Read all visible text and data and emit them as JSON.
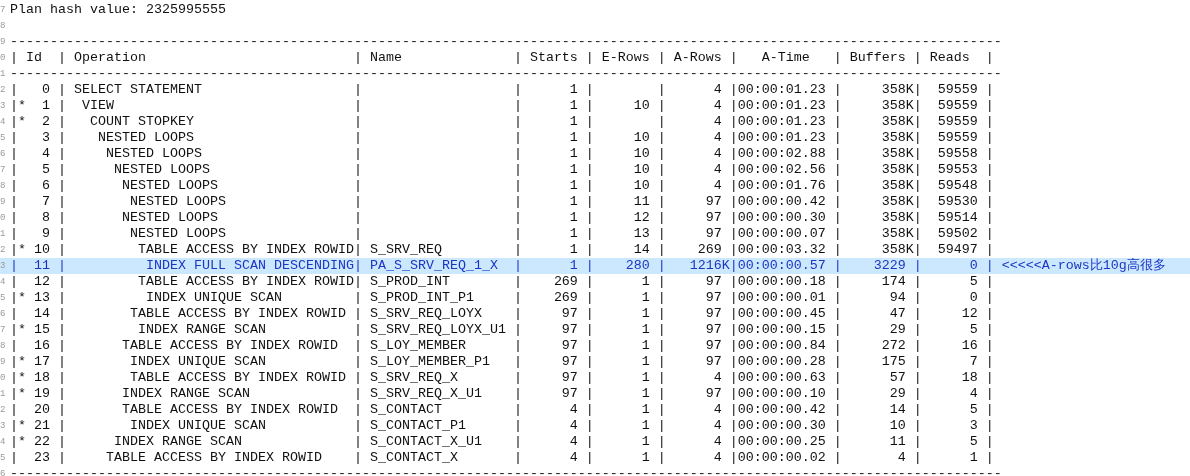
{
  "editor": {
    "lines": [
      {
        "number": "7",
        "text": "Plan hash value: 2325995555",
        "selected": false
      },
      {
        "number": "8",
        "selected": false
      },
      {
        "number": "9",
        "text": "----------------------------------------------------------------------------------------------------------------------------",
        "selected": false
      },
      {
        "number": "0",
        "text": "| Id  | Operation                          | Name              | Starts | E-Rows | A-Rows |   A-Time   | Buffers | Reads  |",
        "selected": false
      },
      {
        "number": "1",
        "text": "----------------------------------------------------------------------------------------------------------------------------",
        "selected": false
      },
      {
        "number": "2",
        "text": "|   0 | SELECT STATEMENT                   |                   |      1 |        |      4 |00:00:01.23 |     358K|  59559 |",
        "selected": false
      },
      {
        "number": "3",
        "text": "|*  1 |  VIEW                              |                   |      1 |     10 |      4 |00:00:01.23 |     358K|  59559 |",
        "selected": false
      },
      {
        "number": "4",
        "text": "|*  2 |   COUNT STOPKEY                    |                   |      1 |        |      4 |00:00:01.23 |     358K|  59559 |",
        "selected": false
      },
      {
        "number": "5",
        "text": "|   3 |    NESTED LOOPS                    |                   |      1 |     10 |      4 |00:00:01.23 |     358K|  59559 |",
        "selected": false
      },
      {
        "number": "6",
        "text": "|   4 |     NESTED LOOPS                   |                   |      1 |     10 |      4 |00:00:02.88 |     358K|  59558 |",
        "selected": false
      },
      {
        "number": "7",
        "text": "|   5 |      NESTED LOOPS                  |                   |      1 |     10 |      4 |00:00:02.56 |     358K|  59553 |",
        "selected": false
      },
      {
        "number": "8",
        "text": "|   6 |       NESTED LOOPS                 |                   |      1 |     10 |      4 |00:00:01.76 |     358K|  59548 |",
        "selected": false
      },
      {
        "number": "9",
        "text": "|   7 |        NESTED LOOPS                |                   |      1 |     11 |     97 |00:00:00.42 |     358K|  59530 |",
        "selected": false
      },
      {
        "number": "0",
        "text": "|   8 |       NESTED LOOPS                 |                   |      1 |     12 |     97 |00:00:00.30 |     358K|  59514 |",
        "selected": false
      },
      {
        "number": "1",
        "text": "|   9 |        NESTED LOOPS                |                   |      1 |     13 |     97 |00:00:00.07 |     358K|  59502 |",
        "selected": false
      },
      {
        "number": "2",
        "text": "|* 10 |         TABLE ACCESS BY INDEX ROWID| S_SRV_REQ         |      1 |     14 |    269 |00:00:03.32 |     358K|  59497 |",
        "selected": false
      },
      {
        "number": "3",
        "text": "|  11 |          INDEX FULL SCAN DESCENDING| PA_S_SRV_REQ_1_X  |      1 |    280 |   1216K|00:00:00.57 |    3229 |      0 | <<<<<A-rows比10g高很多",
        "selected": true
      },
      {
        "number": "4",
        "text": "|  12 |         TABLE ACCESS BY INDEX ROWID| S_PROD_INT        |    269 |      1 |     97 |00:00:00.18 |     174 |      5 |",
        "selected": false
      },
      {
        "number": "5",
        "text": "|* 13 |          INDEX UNIQUE SCAN         | S_PROD_INT_P1     |    269 |      1 |     97 |00:00:00.01 |      94 |      0 |",
        "selected": false
      },
      {
        "number": "6",
        "text": "|  14 |        TABLE ACCESS BY INDEX ROWID | S_SRV_REQ_LOYX    |     97 |      1 |     97 |00:00:00.45 |      47 |     12 |",
        "selected": false
      },
      {
        "number": "7",
        "text": "|* 15 |         INDEX RANGE SCAN           | S_SRV_REQ_LOYX_U1 |     97 |      1 |     97 |00:00:00.15 |      29 |      5 |",
        "selected": false
      },
      {
        "number": "8",
        "text": "|  16 |       TABLE ACCESS BY INDEX ROWID  | S_LOY_MEMBER      |     97 |      1 |     97 |00:00:00.84 |     272 |     16 |",
        "selected": false
      },
      {
        "number": "9",
        "text": "|* 17 |        INDEX UNIQUE SCAN           | S_LOY_MEMBER_P1   |     97 |      1 |     97 |00:00:00.28 |     175 |      7 |",
        "selected": false
      },
      {
        "number": "0",
        "text": "|* 18 |        TABLE ACCESS BY INDEX ROWID | S_SRV_REQ_X       |     97 |      1 |      4 |00:00:00.63 |      57 |     18 |",
        "selected": false
      },
      {
        "number": "1",
        "text": "|* 19 |       INDEX RANGE SCAN             | S_SRV_REQ_X_U1    |     97 |      1 |     97 |00:00:00.10 |      29 |      4 |",
        "selected": false
      },
      {
        "number": "2",
        "text": "|  20 |       TABLE ACCESS BY INDEX ROWID  | S_CONTACT         |      4 |      1 |      4 |00:00:00.42 |      14 |      5 |",
        "selected": false
      },
      {
        "number": "3",
        "text": "|* 21 |        INDEX UNIQUE SCAN           | S_CONTACT_P1      |      4 |      1 |      4 |00:00:00.30 |      10 |      3 |",
        "selected": false
      },
      {
        "number": "4",
        "text": "|* 22 |      INDEX RANGE SCAN              | S_CONTACT_X_U1    |      4 |      1 |      4 |00:00:00.25 |      11 |      5 |",
        "selected": false
      },
      {
        "number": "5",
        "text": "|  23 |     TABLE ACCESS BY INDEX ROWID    | S_CONTACT_X       |      4 |      1 |      4 |00:00:00.02 |       4 |      1 |",
        "selected": false
      },
      {
        "number": "6",
        "text": "----------------------------------------------------------------------------------------------------------------------------",
        "selected": false
      }
    ]
  }
}
